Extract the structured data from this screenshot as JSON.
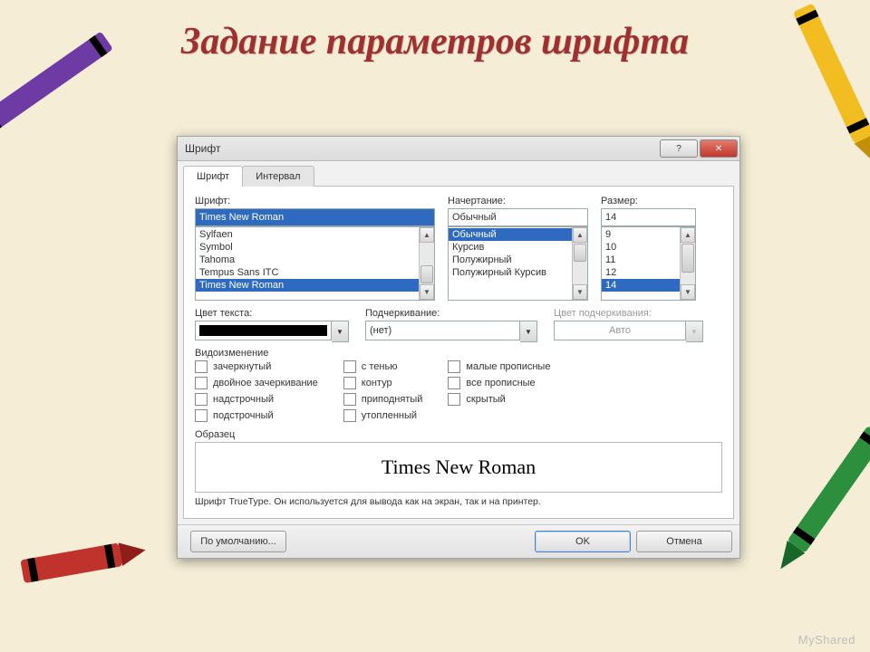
{
  "slide_title": "Задание параметров шрифта",
  "watermark": "MyShared",
  "dialog": {
    "title": "Шрифт",
    "tabs": {
      "font": "Шрифт",
      "interval": "Интервал"
    },
    "labels": {
      "font": "Шрифт:",
      "style": "Начертание:",
      "size": "Размер:",
      "color": "Цвет текста:",
      "underline": "Подчеркивание:",
      "underline_color": "Цвет подчеркивания:",
      "effects": "Видоизменение",
      "sample": "Образец"
    },
    "font": {
      "value": "Times New Roman",
      "list": [
        "Sylfaen",
        "Symbol",
        "Tahoma",
        "Tempus Sans ITC",
        "Times New Roman"
      ],
      "selected_index": 4
    },
    "style": {
      "value": "Обычный",
      "list": [
        "Обычный",
        "Курсив",
        "Полужирный",
        "Полужирный Курсив"
      ],
      "selected_index": 0
    },
    "size": {
      "value": "14",
      "list": [
        "9",
        "10",
        "11",
        "12",
        "14"
      ],
      "selected_index": 4
    },
    "underline": {
      "value": "(нет)"
    },
    "underline_color": {
      "value": "Авто"
    },
    "effects": {
      "col1": [
        "зачеркнутый",
        "двойное зачеркивание",
        "надстрочный",
        "подстрочный"
      ],
      "col2": [
        "с тенью",
        "контур",
        "приподнятый",
        "утопленный"
      ],
      "col3": [
        "малые прописные",
        "все прописные",
        "скрытый"
      ]
    },
    "sample_text": "Times New Roman",
    "hint": "Шрифт TrueType. Он используется для вывода как на экран, так и на принтер.",
    "buttons": {
      "default": "По умолчанию...",
      "ok": "OK",
      "cancel": "Отмена"
    }
  }
}
